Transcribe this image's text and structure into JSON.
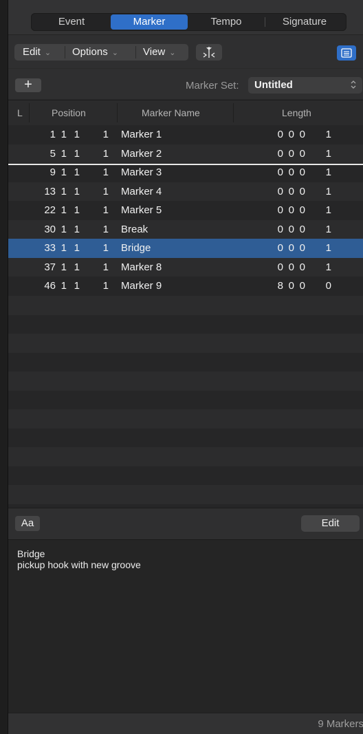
{
  "tabs": {
    "event": "Event",
    "marker": "Marker",
    "tempo": "Tempo",
    "signature": "Signature",
    "active": "Marker"
  },
  "toolbar": {
    "edit": "Edit",
    "options": "Options",
    "view": "View",
    "chevron": "⌄",
    "icons": [
      "marker-catch-icon",
      "list-view-icon"
    ]
  },
  "marker_set": {
    "add": "+",
    "label": "Marker Set:",
    "value": "Untitled",
    "arrows": "⌃⌄"
  },
  "columns": {
    "lock": "L",
    "position": "Position",
    "name": "Marker Name",
    "length": "Length"
  },
  "markers": [
    {
      "bar": "1",
      "beat": "1",
      "div": "1",
      "tick": "1",
      "name": "Marker 1",
      "len1": "0",
      "len2": "0",
      "len3": "0",
      "len4": "1"
    },
    {
      "bar": "5",
      "beat": "1",
      "div": "1",
      "tick": "1",
      "name": "Marker 2",
      "len1": "0",
      "len2": "0",
      "len3": "0",
      "len4": "1"
    },
    {
      "bar": "9",
      "beat": "1",
      "div": "1",
      "tick": "1",
      "name": "Marker 3",
      "len1": "0",
      "len2": "0",
      "len3": "0",
      "len4": "1"
    },
    {
      "bar": "13",
      "beat": "1",
      "div": "1",
      "tick": "1",
      "name": "Marker 4",
      "len1": "0",
      "len2": "0",
      "len3": "0",
      "len4": "1"
    },
    {
      "bar": "22",
      "beat": "1",
      "div": "1",
      "tick": "1",
      "name": "Marker 5",
      "len1": "0",
      "len2": "0",
      "len3": "0",
      "len4": "1"
    },
    {
      "bar": "30",
      "beat": "1",
      "div": "1",
      "tick": "1",
      "name": "Break",
      "len1": "0",
      "len2": "0",
      "len3": "0",
      "len4": "1"
    },
    {
      "bar": "33",
      "beat": "1",
      "div": "1",
      "tick": "1",
      "name": "Bridge",
      "len1": "0",
      "len2": "0",
      "len3": "0",
      "len4": "1"
    },
    {
      "bar": "37",
      "beat": "1",
      "div": "1",
      "tick": "1",
      "name": "Marker 8",
      "len1": "0",
      "len2": "0",
      "len3": "0",
      "len4": "1"
    },
    {
      "bar": "46",
      "beat": "1",
      "div": "1",
      "tick": "1",
      "name": "Marker 9",
      "len1": "8",
      "len2": "0",
      "len3": "0",
      "len4": "0"
    }
  ],
  "selected_marker": "Bridge",
  "text_panel": {
    "font_button": "Aa",
    "edit_button": "Edit",
    "line1": "Bridge",
    "line2": "pickup hook with new groove"
  },
  "footer": {
    "count": "9 Markers"
  },
  "colors": {
    "accent": "#2f6fc8",
    "selection": "#2f5d95",
    "background": "#262627"
  }
}
